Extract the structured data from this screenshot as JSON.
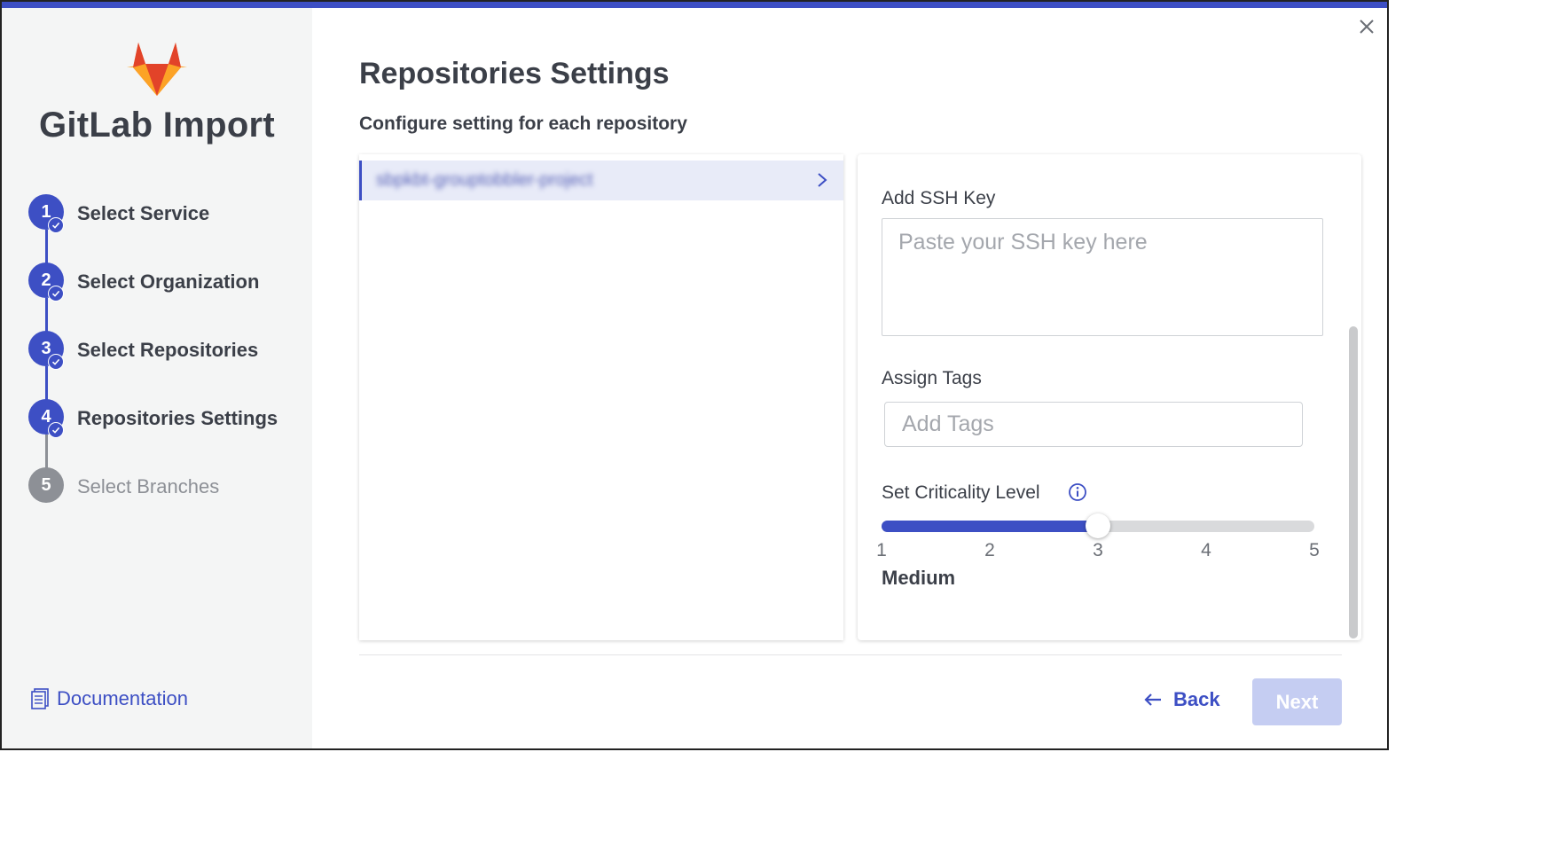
{
  "app": {
    "title": "GitLab Import",
    "logo_icon": "gitlab-logo",
    "close_icon": "close-icon"
  },
  "steps": [
    {
      "number": "1",
      "label": "Select Service",
      "state": "completed"
    },
    {
      "number": "2",
      "label": "Select Organization",
      "state": "completed"
    },
    {
      "number": "3",
      "label": "Select Repositories",
      "state": "completed"
    },
    {
      "number": "4",
      "label": "Repositories Settings",
      "state": "current"
    },
    {
      "number": "5",
      "label": "Select Branches",
      "state": "pending"
    }
  ],
  "sidebar": {
    "documentation_label": "Documentation",
    "documentation_icon": "document-icon"
  },
  "main": {
    "title": "Repositories Settings",
    "subtitle": "Configure setting for each repository"
  },
  "repositories": [
    {
      "name": "sbpkbt-grouptobbler-project",
      "selected": true,
      "blurred": true
    }
  ],
  "settings": {
    "ssh_label": "Add SSH Key",
    "ssh_placeholder": "Paste your SSH key here",
    "ssh_value": "",
    "tags_label": "Assign Tags",
    "tags_placeholder": "Add Tags",
    "criticality_label": "Set Criticality Level",
    "criticality_info_icon": "info-icon",
    "criticality": {
      "min": 1,
      "max": 5,
      "value": 3,
      "ticks": [
        "1",
        "2",
        "3",
        "4",
        "5"
      ],
      "level_text": "Medium"
    }
  },
  "footer": {
    "back_label": "Back",
    "back_icon": "arrow-left-icon",
    "next_label": "Next",
    "next_disabled": true
  },
  "colors": {
    "accent": "#3d4fc4",
    "inactive": "#8d9096",
    "next_disabled_bg": "#c5cdf2",
    "selected_row_bg": "#e8ebf8"
  }
}
